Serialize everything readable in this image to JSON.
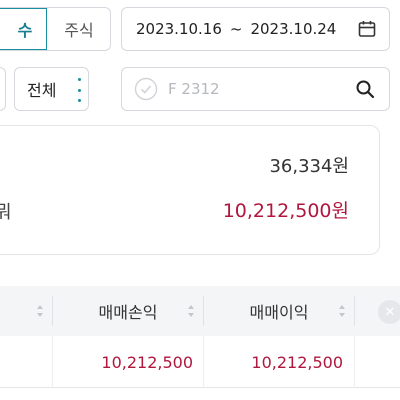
{
  "filters": {
    "segment_active": "수",
    "segment_inactive": "주식",
    "date_start": "2023.10.16",
    "date_separator": "~",
    "date_end": "2023.10.24",
    "select_value": "전체",
    "search_placeholder": "F 2312"
  },
  "summary": {
    "value_1": "36,334원",
    "value_2": "10,212,500원",
    "label_fragment": "뭐"
  },
  "table": {
    "headers": [
      "매매손익",
      "매매이익"
    ],
    "row": [
      "10,212,500",
      "10,212,500"
    ]
  },
  "colors": {
    "accent": "#1a8fa0",
    "profit_red": "#b0173e"
  }
}
